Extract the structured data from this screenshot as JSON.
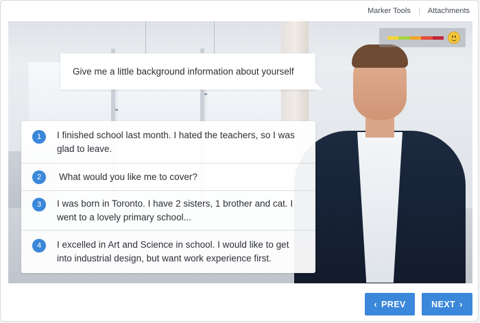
{
  "toolbar": {
    "marker_tools": "Marker Tools",
    "attachments": "Attachments"
  },
  "scene": {
    "character_image": "presenter-man-in-suit",
    "mood_meter": {
      "colors": [
        "#f4d43b",
        "#a6d247",
        "#f0a630",
        "#e44d3a",
        "#c2253a"
      ],
      "icon": "smiley-icon"
    }
  },
  "question": "Give me a little background information about yourself",
  "answers": [
    {
      "number": "1",
      "text": "I finished school last month. I hated the teachers, so I was glad to leave."
    },
    {
      "number": "2",
      "text": "What would you like me to cover?"
    },
    {
      "number": "3",
      "text": "I was born in Toronto. I have 2 sisters, 1 brother and cat. I went to a lovely primary school..."
    },
    {
      "number": "4",
      "text": "I excelled in Art and Science in school. I would like to get into industrial design, but want work experience first."
    }
  ],
  "footer": {
    "prev_label": "PREV",
    "next_label": "NEXT",
    "prev_icon": "chevron-left-icon",
    "next_icon": "chevron-right-icon",
    "accent": "#3b87d9"
  }
}
